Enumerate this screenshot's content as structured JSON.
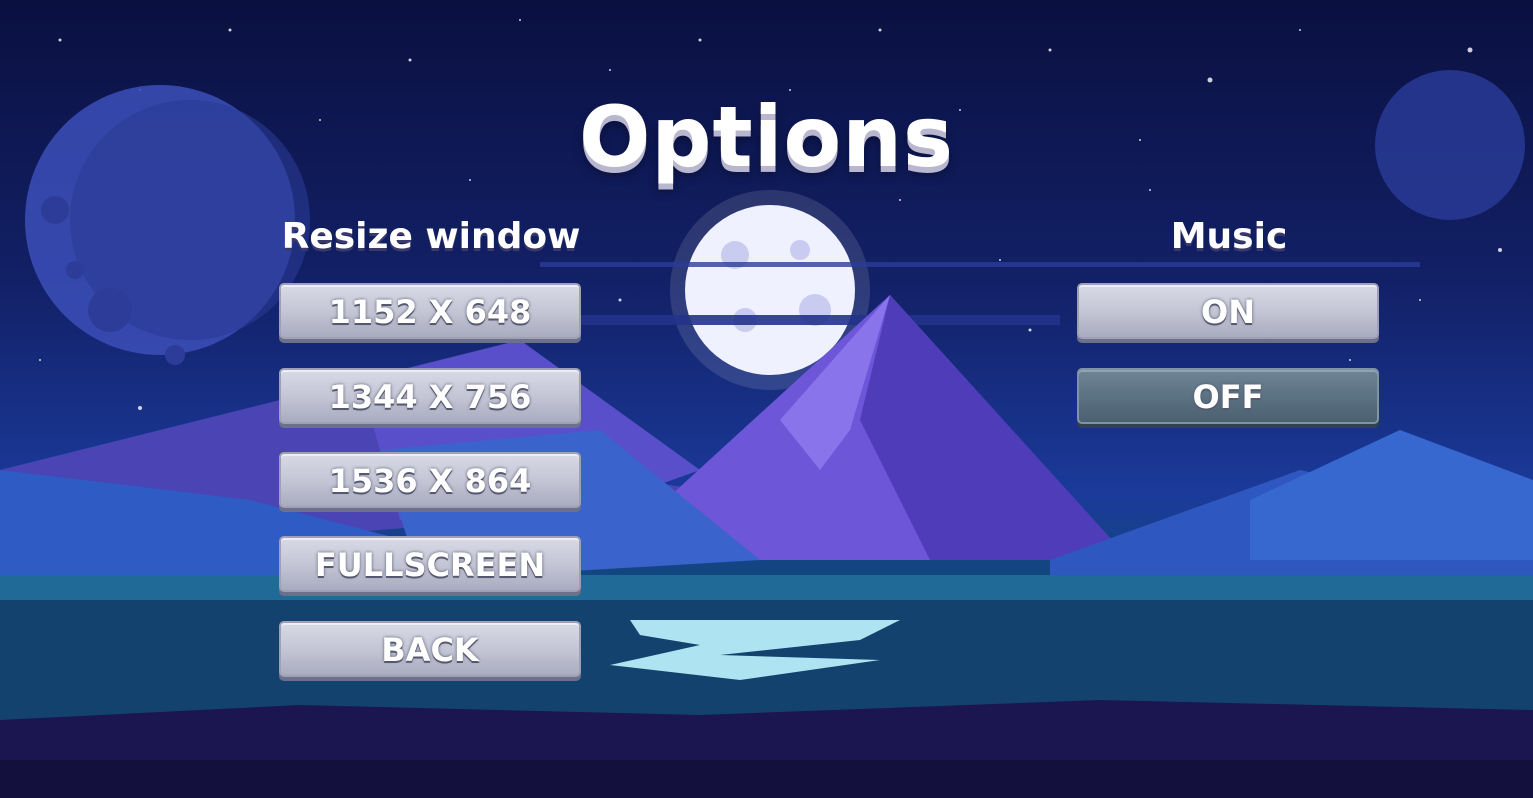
{
  "screen": {
    "title": "Options"
  },
  "resize": {
    "label": "Resize window",
    "options": [
      "1152 X 648",
      "1344 X 756",
      "1536 X 864",
      "FULLSCREEN"
    ],
    "back_label": "BACK"
  },
  "music": {
    "label": "Music",
    "on_label": "ON",
    "off_label": "OFF",
    "selected": "OFF"
  },
  "colors": {
    "button_face": "#c2c4d4",
    "button_selected": "#5a7182",
    "text": "#ffffff"
  }
}
